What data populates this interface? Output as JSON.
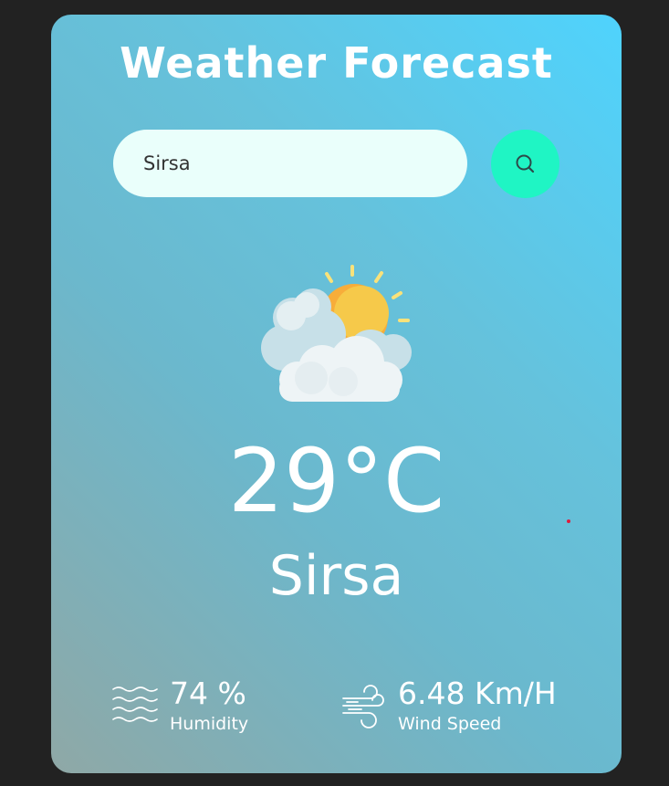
{
  "app": {
    "title": "Weather Forecast"
  },
  "search": {
    "value": "Sirsa",
    "placeholder": "",
    "button_icon": "search-icon"
  },
  "weather": {
    "icon": "sun-behind-clouds-icon",
    "temperature": "29°C",
    "city": "Sirsa"
  },
  "details": {
    "humidity": {
      "value": "74 %",
      "label": "Humidity",
      "icon": "humidity-waves-icon"
    },
    "wind": {
      "value": "6.48 Km/H",
      "label": "Wind Speed",
      "icon": "wind-icon"
    }
  },
  "colors": {
    "background": "#222222",
    "card_gradient_start": "#4fd3fd",
    "card_gradient_end": "#8fa8a6",
    "search_field": "#eafffb",
    "search_button": "#1ff5c4",
    "text": "#ffffff"
  }
}
